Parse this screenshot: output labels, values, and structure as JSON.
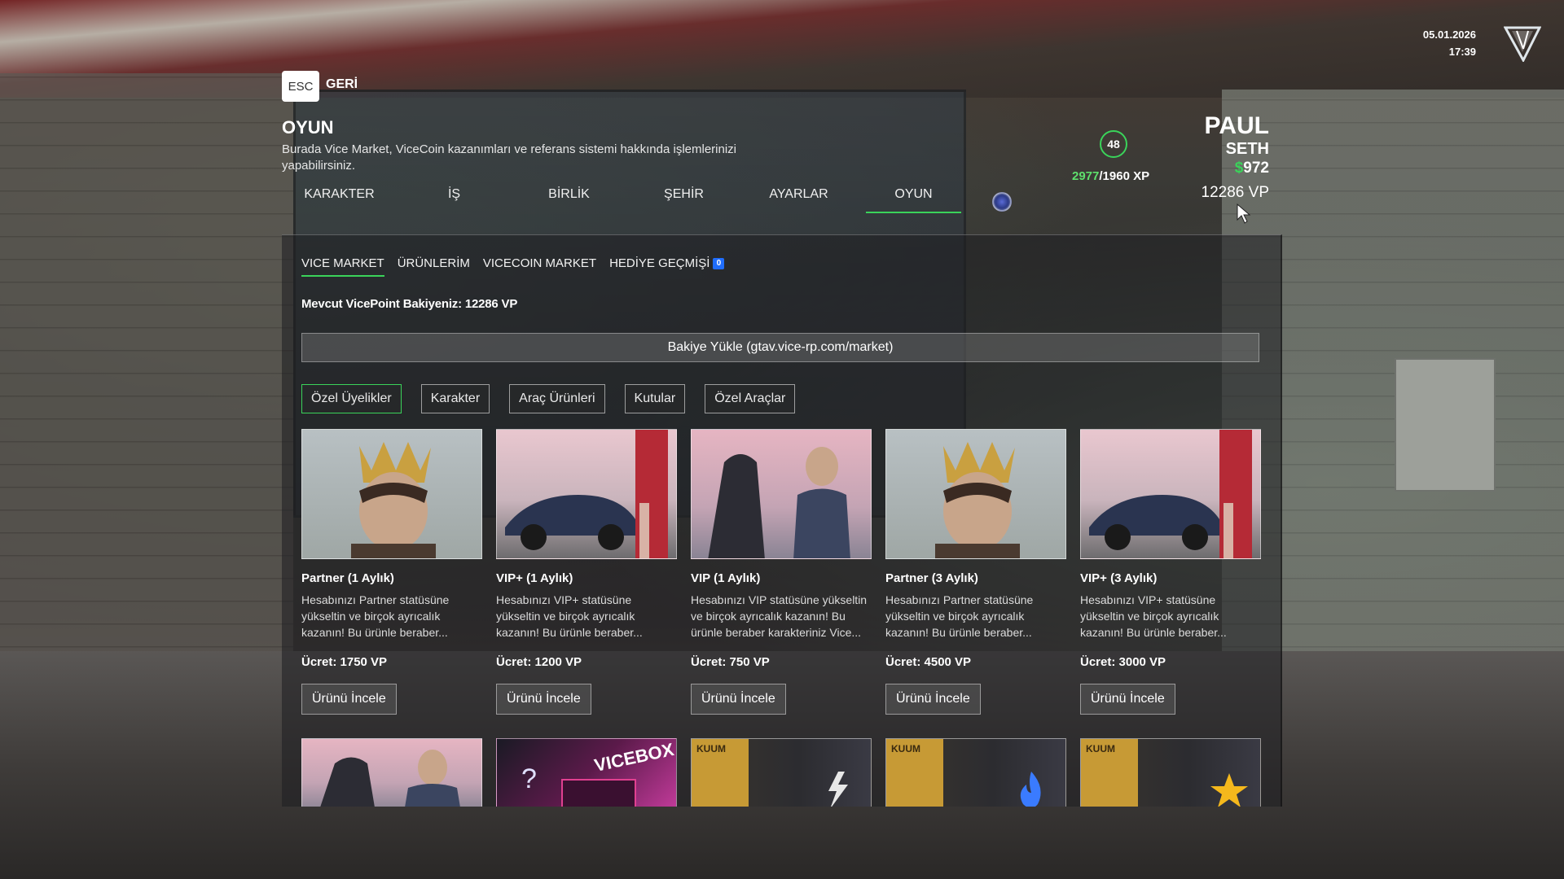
{
  "clock": {
    "date": "05.01.2026",
    "time": "17:39"
  },
  "nav": {
    "esc_key": "ESC",
    "back_label": "GERİ"
  },
  "page": {
    "title": "OYUN",
    "description": "Burada Vice Market, ViceCoin kazanımları ve referans sistemi hakkında işlemlerinizi yapabilirsiniz."
  },
  "top_tabs": [
    {
      "label": "KARAKTER",
      "active": false
    },
    {
      "label": "İŞ",
      "active": false
    },
    {
      "label": "BİRLİK",
      "active": false
    },
    {
      "label": "ŞEHİR",
      "active": false
    },
    {
      "label": "AYARLAR",
      "active": false
    },
    {
      "label": "OYUN",
      "active": true
    }
  ],
  "player": {
    "level": "48",
    "xp_current": "2977",
    "xp_total": "/1960 XP",
    "first_name": "PAUL",
    "last_name": "SETH",
    "money_symbol": "$",
    "money": "972",
    "vp": "12286 VP"
  },
  "sub_tabs": [
    {
      "label": "VICE MARKET",
      "active": true
    },
    {
      "label": "ÜRÜNLERİM",
      "active": false
    },
    {
      "label": "VICECOIN MARKET",
      "active": false
    },
    {
      "label": "HEDİYE GEÇMİŞİ",
      "active": false,
      "badge": "0"
    }
  ],
  "balance_text": "Mevcut VicePoint Bakiyeniz: 12286 VP",
  "topup_label": "Bakiye Yükle (gtav.vice-rp.com/market)",
  "filters": [
    {
      "label": "Özel Üyelikler",
      "active": true
    },
    {
      "label": "Karakter",
      "active": false
    },
    {
      "label": "Araç Ürünleri",
      "active": false
    },
    {
      "label": "Kutular",
      "active": false
    },
    {
      "label": "Özel Araçlar",
      "active": false
    }
  ],
  "products": [
    {
      "title": "Partner (1 Aylık)",
      "desc": "Hesabınızı Partner statüsüne yükseltin ve birçok ayrıcalık kazanın! Bu ürünle beraber...",
      "price": "Ücret: 1750 VP",
      "button": "Ürünü İncele",
      "image": "partner-crown-art"
    },
    {
      "title": "VIP+ (1 Aylık)",
      "desc": "Hesabınızı VIP+ statüsüne yükseltin ve birçok ayrıcalık kazanın! Bu ürünle beraber...",
      "price": "Ücret: 1200 VP",
      "button": "Ürünü İncele",
      "image": "vipplus-car-art"
    },
    {
      "title": "VIP (1 Aylık)",
      "desc": "Hesabınızı VIP statüsüne yükseltin ve birçok ayrıcalık kazanın! Bu ürünle beraber karakteriniz Vice...",
      "price": "Ücret: 750 VP",
      "button": "Ürünü İncele",
      "image": "vip-suit-art"
    },
    {
      "title": "Partner (3 Aylık)",
      "desc": "Hesabınızı Partner statüsüne yükseltin ve birçok ayrıcalık kazanın! Bu ürünle beraber...",
      "price": "Ücret: 4500 VP",
      "button": "Ürünü İncele",
      "image": "partner-crown-art"
    },
    {
      "title": "VIP+ (3 Aylık)",
      "desc": "Hesabınızı VIP+ statüsüne yükseltin ve birçok ayrıcalık kazanın! Bu ürünle beraber...",
      "price": "Ücret: 3000 VP",
      "button": "Ürünü İncele",
      "image": "vipplus-car-art"
    }
  ],
  "row2_images": [
    {
      "image": "vip-suit-art",
      "label": ""
    },
    {
      "image": "vicebox-art",
      "label": "VICEBOX"
    },
    {
      "image": "kuum-bag-lightning-art",
      "label": "KUUM"
    },
    {
      "image": "kuum-bag-flame-art",
      "label": "KUUM"
    },
    {
      "image": "kuum-bag-star-art",
      "label": "KUUM"
    }
  ],
  "colors": {
    "accent": "#3ad35a",
    "badge_blue": "#1f6dfc"
  }
}
